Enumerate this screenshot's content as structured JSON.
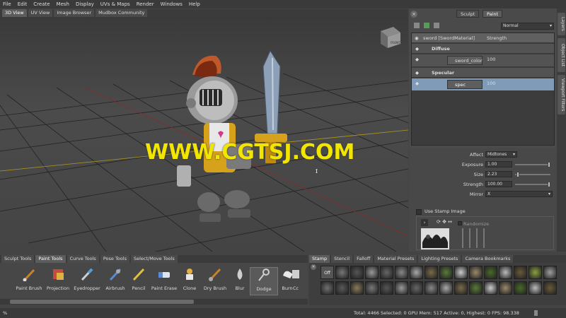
{
  "menu": [
    "File",
    "Edit",
    "Create",
    "Mesh",
    "Display",
    "UVs & Maps",
    "Render",
    "Windows",
    "Help"
  ],
  "view_tabs": [
    "3D View",
    "UV View",
    "Image Browser",
    "Mudbox Community"
  ],
  "viewport": {
    "watermark": "WWW.CGTSJ.COM",
    "cube_label": "FRONT"
  },
  "right": {
    "top_tabs": [
      "Sculpt",
      "Paint"
    ],
    "blend_mode": "Normal",
    "layer_name": "sword [SwordMaterial]",
    "layer_channel": "Strength",
    "diffuse_label": "Diffuse",
    "diffuse_layer": "sword_color",
    "diffuse_value": "100",
    "specular_label": "Specular",
    "specular_layer": "spec",
    "specular_value": "100",
    "affect_label": "Affect",
    "affect_value": "Midtones",
    "exposure_label": "Exposure",
    "exposure_value": "1.00",
    "size_label": "Size",
    "size_value": "2.23",
    "strength_label": "Strength",
    "strength_value": "100.00",
    "mirror_label": "Mirror",
    "mirror_value": "X",
    "use_stamp": "Use Stamp Image",
    "randomize": "Randomize"
  },
  "side_tabs": [
    "Layers",
    "Object List",
    "Viewport Filters"
  ],
  "tool_tabs": [
    "Sculpt Tools",
    "Paint Tools",
    "Curve Tools",
    "Pose Tools",
    "Select/Move Tools"
  ],
  "tools": [
    "Paint Brush",
    "Projection",
    "Eyedropper",
    "Airbrush",
    "Pencil",
    "Paint Erase",
    "Clone",
    "Dry Brush",
    "Blur",
    "Dodge",
    "Burn",
    "Cc"
  ],
  "stamp_tabs": [
    "Stamp",
    "Stencil",
    "Falloff",
    "Material Presets",
    "Lighting Presets",
    "Camera Bookmarks"
  ],
  "stamp_off": "Off",
  "status": {
    "left": "%",
    "right": "Total: 4466   Selected: 0   GPU Mem: 517   Active: 0, Highest: 0   FPS: 98.338"
  }
}
